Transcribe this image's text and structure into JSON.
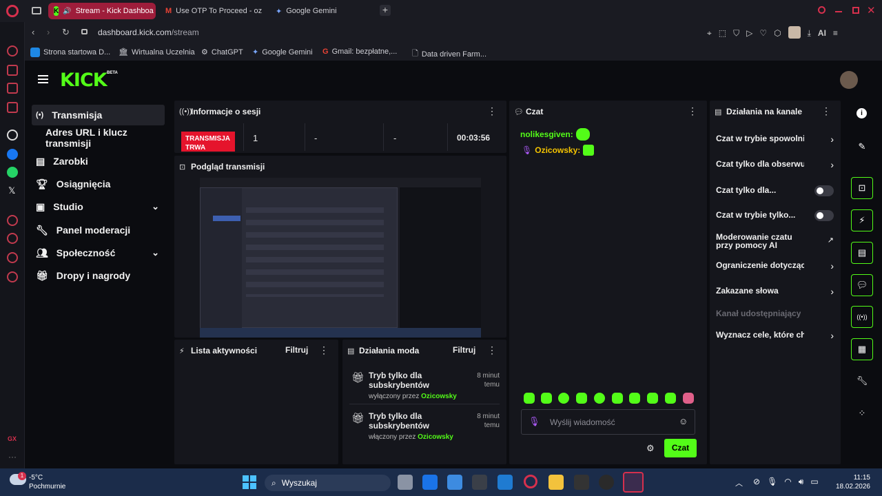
{
  "browser": {
    "tabs": [
      {
        "label": "Stream - Kick Dashboa",
        "icon": "kick-icon"
      },
      {
        "label": "Use OTP To Proceed - oz",
        "icon": "gmail-icon"
      },
      {
        "label": "Google Gemini",
        "icon": "gemini-icon"
      }
    ],
    "url_domain": "dashboard.kick.com",
    "url_path": "/stream",
    "ai_label": "AI",
    "bookmarks": [
      "Strona startowa D...",
      "Wirtualna Uczelnia",
      "ChatGPT",
      "Google Gemini",
      "Gmail: bezpłatne,...",
      "Data driven Farm..."
    ]
  },
  "kick": {
    "logo": "KICK",
    "logo_badge": "BETA",
    "nav": [
      {
        "label": "Transmisja",
        "selected": true
      },
      {
        "label": "Adres URL i klucz transmisji"
      },
      {
        "label": "Zarobki"
      },
      {
        "label": "Osiągnięcia"
      },
      {
        "label": "Studio"
      },
      {
        "label": "Panel moderacji"
      },
      {
        "label": "Społeczność"
      },
      {
        "label": "Dropy i nagrody"
      }
    ],
    "session": {
      "title": "Informacje o sesji",
      "live_label": "TRANSMISJA TRWA",
      "viewers": "1",
      "stat2": "-",
      "stat3": "-",
      "duration": "00:03:56"
    },
    "preview": {
      "title": "Podgląd transmisji"
    },
    "activity": {
      "title": "Lista aktywności",
      "filter": "Filtruj"
    },
    "modactions": {
      "title": "Działania moda",
      "filter": "Filtruj",
      "items": [
        {
          "title": "Tryb tylko dla subskrybentów",
          "detail": "wyłączony przez",
          "user": "Ozicowsky",
          "time": "8 minut temu"
        },
        {
          "title": "Tryb tylko dla subskrybentów",
          "detail": "włączony przez",
          "user": "Ozicowsky",
          "time": "8 minut temu"
        }
      ]
    },
    "chat": {
      "title": "Czat",
      "messages": [
        {
          "user": "nolikesgiven:",
          "color": "#53fc18"
        },
        {
          "user": "Ozicowsky:",
          "color": "#f5c400"
        }
      ],
      "placeholder": "Wyślij wiadomość",
      "send_label": "Czat"
    },
    "channel_actions": {
      "title": "Działania na kanale",
      "items": [
        {
          "label": "Czat w trybie spowolnionym",
          "kind": "arrow"
        },
        {
          "label": "Czat tylko dla obserwujących",
          "kind": "arrow"
        },
        {
          "label": "Czat tylko dla...",
          "kind": "toggle"
        },
        {
          "label": "Czat w trybie tylko...",
          "kind": "toggle"
        },
        {
          "label": "Moderowanie czatu przy pomocy AI",
          "kind": "external"
        },
        {
          "label": "Ograniczenie dotyczące wieku",
          "kind": "arrow"
        },
        {
          "label": "Zakazane słowa",
          "kind": "arrow"
        },
        {
          "label": "Kanał udostępniający",
          "kind": "disabled"
        },
        {
          "label": "Wyznacz cele, które chcesz",
          "kind": "arrow"
        }
      ]
    },
    "accent": "#53fc18"
  },
  "taskbar": {
    "temp": "-5°C",
    "weather": "Pochmurnie",
    "weather_badge": "1",
    "search": "Wyszukaj",
    "time": "11:15",
    "date": "18.02.2026"
  }
}
